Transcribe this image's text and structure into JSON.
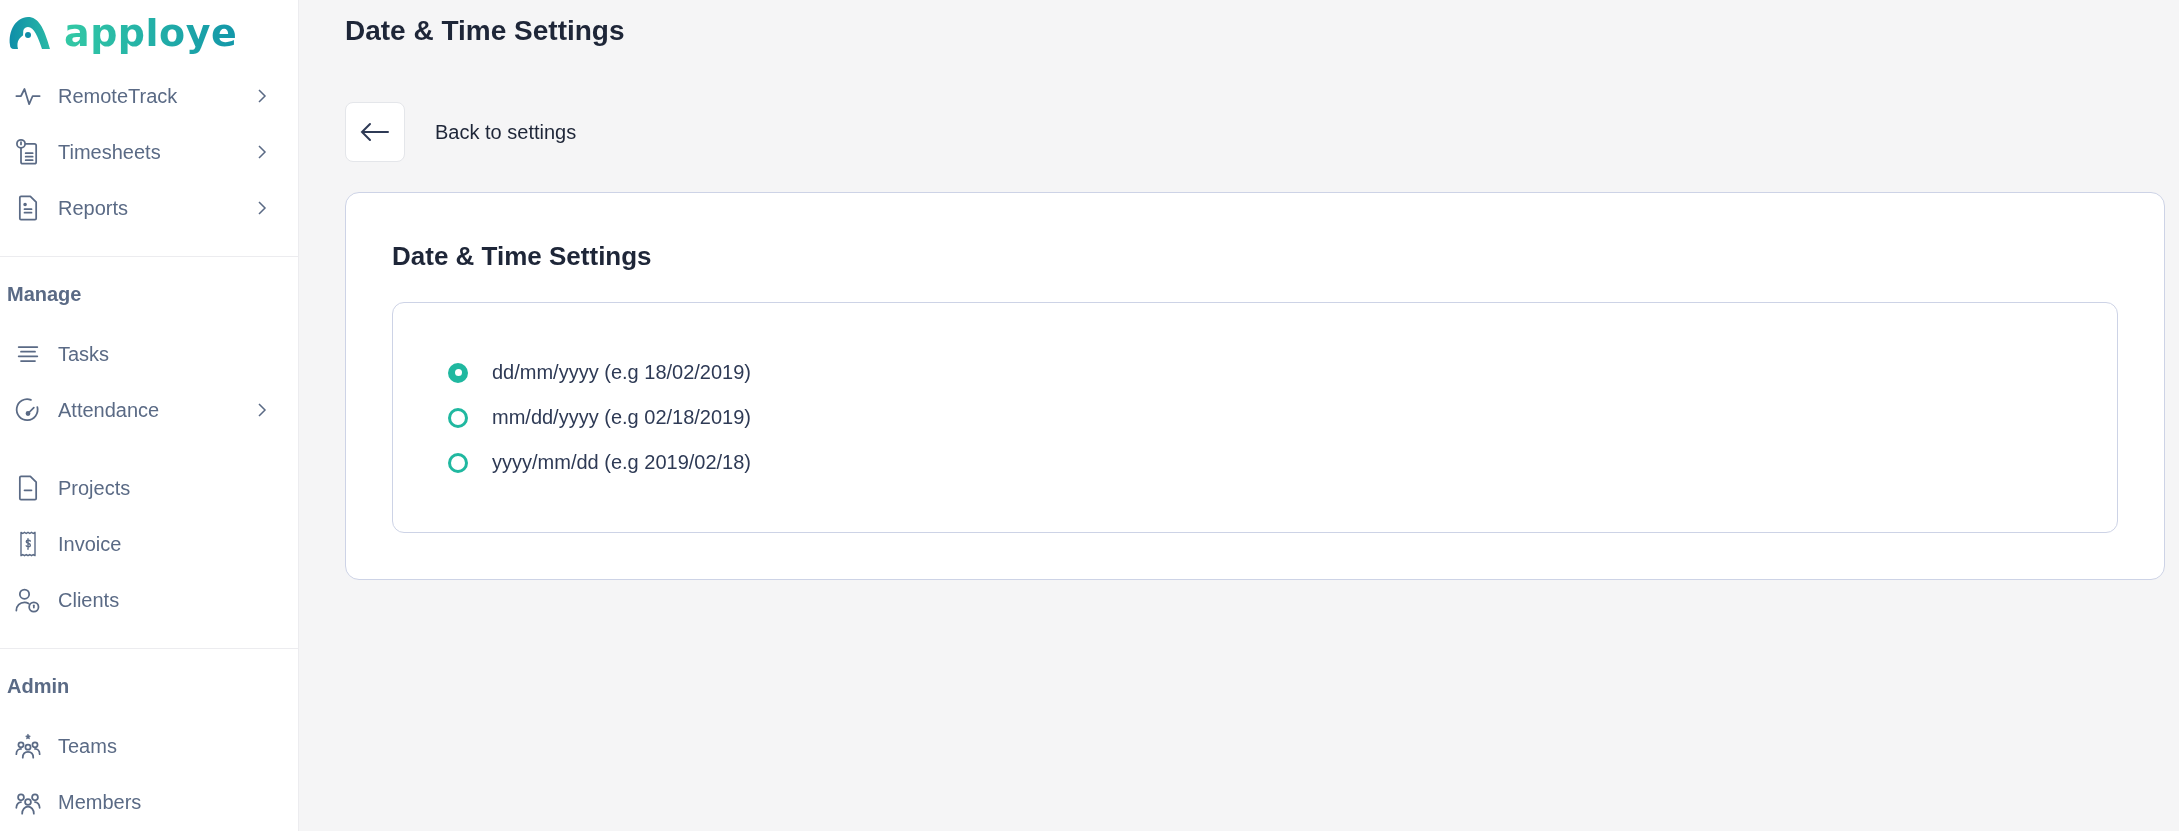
{
  "sidebar": {
    "logo_text": "apploye",
    "sections": [
      {
        "groups": [
          [
            {
              "label": "RemoteTrack",
              "expandable": true
            },
            {
              "label": "Timesheets",
              "expandable": true
            },
            {
              "label": "Reports",
              "expandable": true
            }
          ]
        ]
      },
      {
        "heading": "Manage",
        "groups": [
          [
            {
              "label": "Tasks",
              "expandable": false
            },
            {
              "label": "Attendance",
              "expandable": true
            }
          ],
          [
            {
              "label": "Projects",
              "expandable": false
            },
            {
              "label": "Invoice",
              "expandable": false
            },
            {
              "label": "Clients",
              "expandable": false
            }
          ]
        ]
      },
      {
        "heading": "Admin",
        "groups": [
          [
            {
              "label": "Teams",
              "expandable": false
            },
            {
              "label": "Members",
              "expandable": false
            }
          ]
        ]
      }
    ]
  },
  "page_title": "Date & Time Settings",
  "back_link": "Back to settings",
  "card": {
    "title": "Date & Time Settings",
    "options": [
      {
        "label": "dd/mm/yyyy (e.g 18/02/2019)",
        "selected": true
      },
      {
        "label": "mm/dd/yyyy (e.g 02/18/2019)",
        "selected": false
      },
      {
        "label": "yyyy/mm/dd (e.g 2019/02/18)",
        "selected": false
      }
    ]
  }
}
